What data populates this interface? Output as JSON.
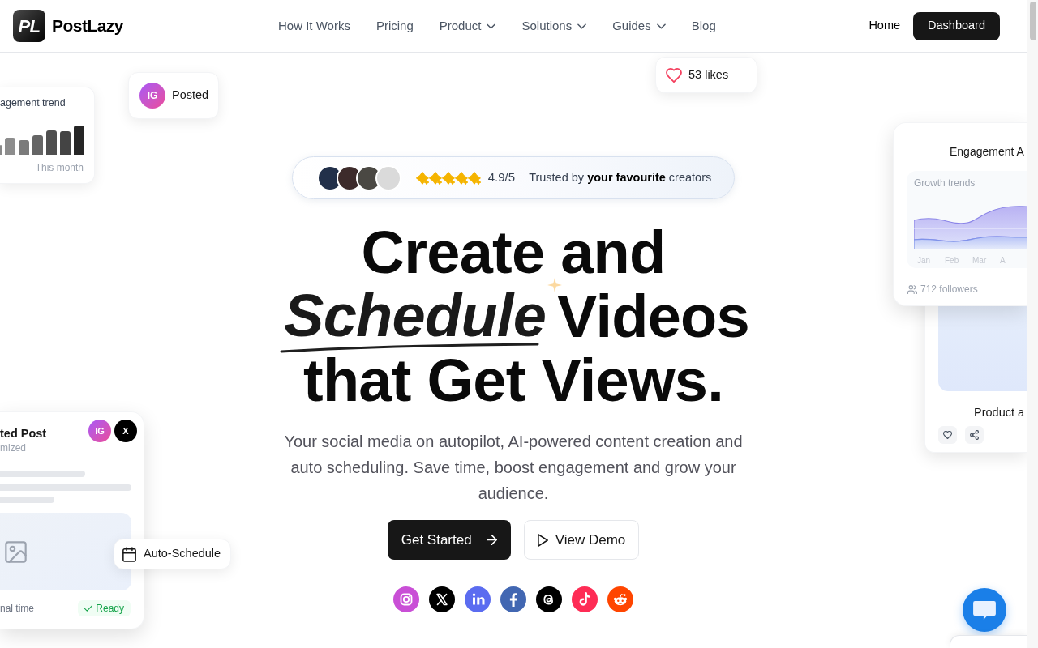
{
  "nav": {
    "logo_mark": "PL",
    "brand": "PostLazy",
    "links": [
      {
        "label": "How It Works",
        "dropdown": false
      },
      {
        "label": "Pricing",
        "dropdown": false
      },
      {
        "label": "Product",
        "dropdown": true
      },
      {
        "label": "Solutions",
        "dropdown": true
      },
      {
        "label": "Guides",
        "dropdown": true
      },
      {
        "label": "Blog",
        "dropdown": false
      }
    ],
    "home": "Home",
    "cta": "Dashboard"
  },
  "likes_card": {
    "label": "53 likes"
  },
  "posted_card": {
    "avatar": {
      "kind": "instagram",
      "label": "IG"
    },
    "label": "Posted"
  },
  "trend_card": {
    "title": "agement trend",
    "caption": "This month"
  },
  "analytics_card": {
    "title": "Engagement A",
    "panel_title": "Growth trends",
    "months": [
      "Jan",
      "Feb",
      "Mar",
      "A"
    ],
    "followers": "712 followers"
  },
  "rating_badge": {
    "stars": 5,
    "score": "4.9/5",
    "text": "Trusted by **your favourite** creators"
  },
  "headline": {
    "line_1": "Create and",
    "highlight": "Schedule",
    "line_2": "Videos",
    "line_3": "that Get Views."
  },
  "product_card": {
    "title": "Product a"
  },
  "post_card": {
    "title": "ted Post",
    "subtitle": "mized",
    "avatars": [
      {
        "kind": "instagram",
        "label": "IG"
      },
      {
        "kind": "x",
        "label": "X"
      }
    ],
    "footer": "nal time",
    "status": "Ready"
  },
  "subtitle": "Your social media on autopilot, AI-powered content creation and auto scheduling. Save time, boost engagement and grow your audience.",
  "buttons": [
    {
      "kind": "primary",
      "label": "Get Started"
    },
    {
      "kind": "secondary",
      "label": "View Demo"
    }
  ],
  "schedule_chip": {
    "label": "Auto-Schedule"
  },
  "social_icons": [
    {
      "kind": "instagram",
      "color": "#c94fd6"
    },
    {
      "kind": "x",
      "color": "#000000"
    },
    {
      "kind": "linkedin",
      "color": "#5b6cf0"
    },
    {
      "kind": "facebook",
      "color": "#4267b2"
    },
    {
      "kind": "threads",
      "color": "#000000"
    },
    {
      "kind": "tiktok",
      "color": "#fe2c55"
    },
    {
      "kind": "reddit",
      "color": "#ff4500"
    }
  ]
}
